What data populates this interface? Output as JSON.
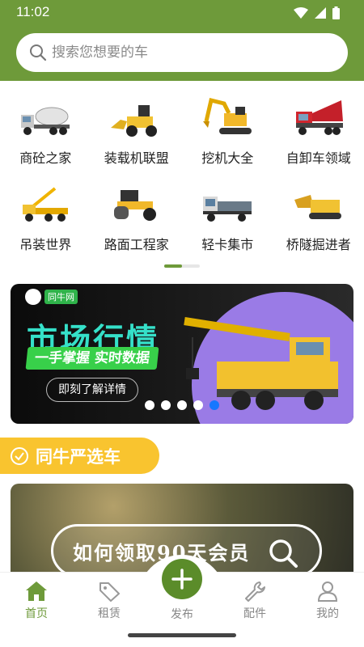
{
  "status_bar": {
    "time": "11:02"
  },
  "search": {
    "placeholder": "搜索您想要的车"
  },
  "categories": [
    {
      "label": "商砼之家",
      "icon": "mixer-truck-icon"
    },
    {
      "label": "装载机联盟",
      "icon": "wheel-loader-icon"
    },
    {
      "label": "挖机大全",
      "icon": "excavator-icon"
    },
    {
      "label": "自卸车领域",
      "icon": "dump-truck-icon"
    },
    {
      "label": "吊装世界",
      "icon": "crane-truck-icon"
    },
    {
      "label": "路面工程家",
      "icon": "road-roller-icon"
    },
    {
      "label": "轻卡集市",
      "icon": "light-truck-icon"
    },
    {
      "label": "桥隧掘进者",
      "icon": "tunnel-boring-icon"
    }
  ],
  "banner": {
    "logo_text": "同牛网",
    "title": "市场行情",
    "subtitle": "一手掌握 实时数据",
    "cta": "即刻了解详情",
    "slide_count": 5,
    "active_slide": 5
  },
  "section": {
    "title": "同牛严选车"
  },
  "promo": {
    "text": "如何领取90天会员"
  },
  "tabbar": {
    "home": "首页",
    "rent": "租赁",
    "publish": "发布",
    "parts": "配件",
    "mine": "我的"
  },
  "colors": {
    "primary": "#6e9a3a",
    "accent_yellow": "#f9c42f",
    "banner_teal": "#35e0c9"
  }
}
